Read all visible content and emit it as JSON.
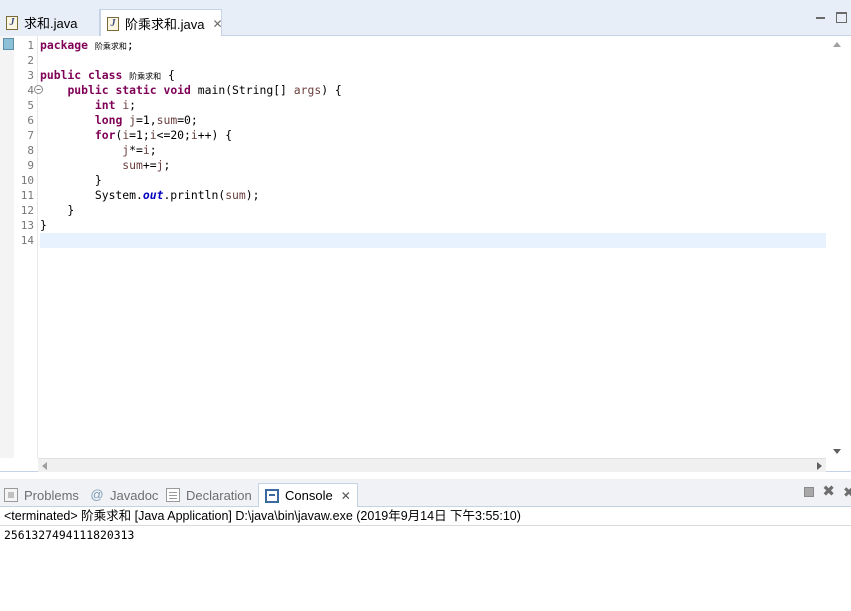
{
  "editor": {
    "tabs": [
      {
        "label": "求和.java",
        "active": false
      },
      {
        "label": "阶乘求和.java",
        "active": true
      }
    ],
    "line_numbers": [
      "1",
      "2",
      "3",
      "4",
      "5",
      "6",
      "7",
      "8",
      "9",
      "10",
      "11",
      "12",
      "13",
      "14"
    ],
    "lines": [
      {
        "tokens": [
          {
            "t": "package",
            "c": "kw"
          },
          {
            "t": " "
          },
          {
            "t": "阶乘求和",
            "c": "cjk"
          },
          {
            "t": ";"
          }
        ]
      },
      {
        "tokens": []
      },
      {
        "tokens": [
          {
            "t": "public",
            "c": "kw"
          },
          {
            "t": " "
          },
          {
            "t": "class",
            "c": "kw"
          },
          {
            "t": " "
          },
          {
            "t": "阶乘求和",
            "c": "cjk"
          },
          {
            "t": " {"
          }
        ]
      },
      {
        "tokens": [
          {
            "t": "    "
          },
          {
            "t": "public",
            "c": "kw"
          },
          {
            "t": " "
          },
          {
            "t": "static",
            "c": "kw"
          },
          {
            "t": " "
          },
          {
            "t": "void",
            "c": "kw"
          },
          {
            "t": " main(String[] "
          },
          {
            "t": "args",
            "c": "var"
          },
          {
            "t": ") {"
          }
        ]
      },
      {
        "tokens": [
          {
            "t": "        "
          },
          {
            "t": "int",
            "c": "kw"
          },
          {
            "t": " "
          },
          {
            "t": "i",
            "c": "var"
          },
          {
            "t": ";"
          }
        ]
      },
      {
        "tokens": [
          {
            "t": "        "
          },
          {
            "t": "long",
            "c": "kw"
          },
          {
            "t": " "
          },
          {
            "t": "j",
            "c": "var"
          },
          {
            "t": "=1,"
          },
          {
            "t": "sum",
            "c": "var"
          },
          {
            "t": "=0;"
          }
        ]
      },
      {
        "tokens": [
          {
            "t": "        "
          },
          {
            "t": "for",
            "c": "kw"
          },
          {
            "t": "("
          },
          {
            "t": "i",
            "c": "var"
          },
          {
            "t": "=1;"
          },
          {
            "t": "i",
            "c": "var"
          },
          {
            "t": "<=20;"
          },
          {
            "t": "i",
            "c": "var"
          },
          {
            "t": "++) {"
          }
        ]
      },
      {
        "tokens": [
          {
            "t": "            "
          },
          {
            "t": "j",
            "c": "var"
          },
          {
            "t": "*="
          },
          {
            "t": "i",
            "c": "var"
          },
          {
            "t": ";"
          }
        ]
      },
      {
        "tokens": [
          {
            "t": "            "
          },
          {
            "t": "sum",
            "c": "var"
          },
          {
            "t": "+="
          },
          {
            "t": "j",
            "c": "var"
          },
          {
            "t": ";"
          }
        ]
      },
      {
        "tokens": [
          {
            "t": "        }"
          }
        ]
      },
      {
        "tokens": [
          {
            "t": "        System."
          },
          {
            "t": "out",
            "c": "field"
          },
          {
            "t": ".println("
          },
          {
            "t": "sum",
            "c": "var"
          },
          {
            "t": ");"
          }
        ]
      },
      {
        "tokens": [
          {
            "t": "    }"
          }
        ]
      },
      {
        "tokens": [
          {
            "t": "}"
          }
        ]
      },
      {
        "tokens": []
      }
    ]
  },
  "panel": {
    "tabs": {
      "problems": "Problems",
      "javadoc": "Javadoc",
      "declaration": "Declaration",
      "console": "Console"
    },
    "console_status": "<terminated> 阶乘求和 [Java Application] D:\\java\\bin\\javaw.exe (2019年9月14日 下午3:55:10)",
    "console_output": "2561327494111820313"
  },
  "colors": {
    "keyword": "#7f0055",
    "variable": "#6a3e3e",
    "static_field": "#0000c0",
    "current_line": "#e8f2fe",
    "tab_bar": "#e7eef8"
  },
  "icons": {
    "java_file": "java-file-icon",
    "close": "close-icon",
    "fold": "fold-collapse-icon",
    "problems": "problems-icon",
    "javadoc": "javadoc-icon",
    "declaration": "declaration-icon",
    "console": "console-icon",
    "terminate": "terminate-icon",
    "remove_launch": "remove-launch-icon",
    "remove_all": "remove-all-icon"
  }
}
